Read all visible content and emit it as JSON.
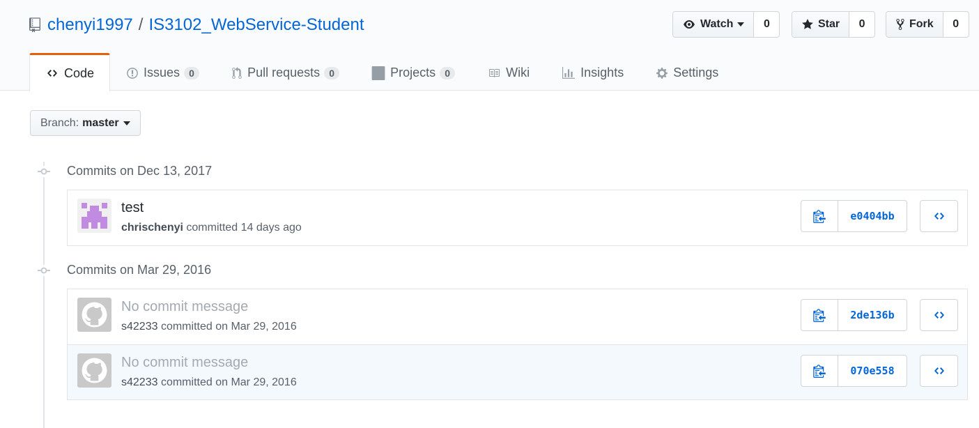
{
  "repo": {
    "owner": "chenyi1997",
    "separator": "/",
    "name": "IS3102_WebService-Student"
  },
  "actions": {
    "watch": {
      "label": "Watch",
      "count": "0"
    },
    "star": {
      "label": "Star",
      "count": "0"
    },
    "fork": {
      "label": "Fork",
      "count": "0"
    }
  },
  "tabs": [
    {
      "label": "Code",
      "icon": "code-icon",
      "selected": true
    },
    {
      "label": "Issues",
      "count": "0",
      "icon": "issue-opened-icon"
    },
    {
      "label": "Pull requests",
      "count": "0",
      "icon": "git-pull-request-icon"
    },
    {
      "label": "Projects",
      "count": "0",
      "icon": "project-icon"
    },
    {
      "label": "Wiki",
      "icon": "book-icon"
    },
    {
      "label": "Insights",
      "icon": "graph-icon"
    },
    {
      "label": "Settings",
      "icon": "gear-icon"
    }
  ],
  "branch": {
    "label": "Branch:",
    "value": "master"
  },
  "groups": [
    {
      "title": "Commits on Dec 13, 2017",
      "commits": [
        {
          "message": "test",
          "author": "chrischenyi",
          "when": "committed 14 days ago",
          "sha": "e0404bb",
          "avatar": "identicon-avatar"
        }
      ]
    },
    {
      "title": "Commits on Mar 29, 2016",
      "commits": [
        {
          "message": "No commit message",
          "author": "s42233",
          "when": "committed on Mar 29, 2016",
          "sha": "2de136b",
          "avatar": "default-octocat-avatar"
        },
        {
          "message": "No commit message",
          "author": "s42233",
          "when": "committed on Mar 29, 2016",
          "sha": "070e558",
          "avatar": "default-octocat-avatar"
        }
      ]
    }
  ],
  "colors": {
    "link": "#0366d6",
    "tab_accent": "#e36209",
    "identicon": "#c08be0"
  }
}
